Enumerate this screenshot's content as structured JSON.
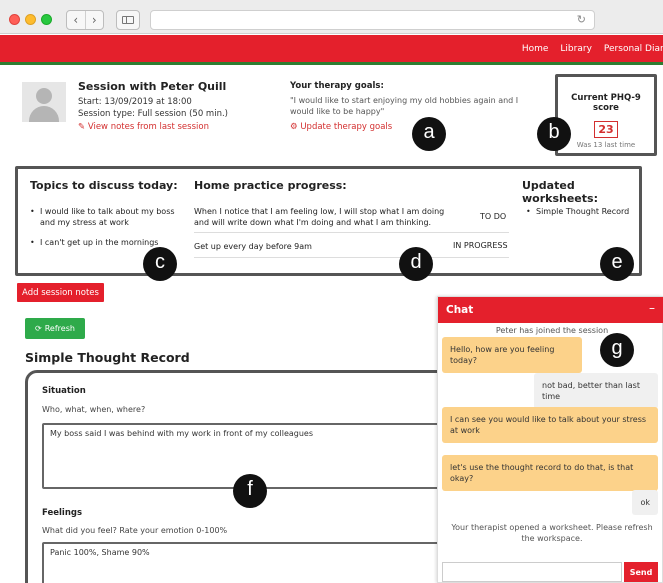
{
  "navbar": {
    "links": [
      "Home",
      "Library",
      "Personal Diary"
    ]
  },
  "session": {
    "title": "Session with Peter Quill",
    "start": "Start: 13/09/2019 at 18:00",
    "type": "Session type: Full session (50 min.)",
    "notes_link": "View notes from last session"
  },
  "goals": {
    "heading": "Your therapy goals:",
    "text": "\"I would like to start enjoying my old hobbies again and I would like to be happy\"",
    "update_link": "Update therapy goals"
  },
  "phq": {
    "heading": "Current PHQ-9 score",
    "score": "23",
    "last": "Was 13 last time"
  },
  "topics": {
    "heading": "Topics to discuss today:",
    "items": [
      "I would like to talk about my boss and my stress at work",
      "I can't get up in the mornings"
    ]
  },
  "home_practice": {
    "heading": "Home practice progress:",
    "items": [
      {
        "text": "When I notice that I am feeling low, I will stop what I am doing and will write down what I'm doing and what I am thinking.",
        "status": "TO DO"
      },
      {
        "text": "Get up every day before 9am",
        "status": "IN PROGRESS"
      }
    ]
  },
  "worksheets": {
    "heading": "Updated worksheets:",
    "items": [
      "Simple Thought Record"
    ]
  },
  "buttons": {
    "add_notes": "Add session notes",
    "refresh": "Refresh"
  },
  "thought_record": {
    "title": "Simple Thought Record",
    "situation_label": "Situation",
    "situation_sub": "Who, what, when, where?",
    "situation_value": "My boss said I was behind with my work in front of my colleagues",
    "feelings_label": "Feelings",
    "feelings_sub": "What did you feel? Rate your emotion 0-100%",
    "feelings_value": "Panic 100%, Shame 90%"
  },
  "chat": {
    "title": "Chat",
    "minimize": "–",
    "joined": "Peter has joined the session",
    "messages": [
      {
        "from": "therapist",
        "text": "Hello, how are you feeling today?"
      },
      {
        "from": "client",
        "text": "not bad, better than last time"
      },
      {
        "from": "therapist",
        "text": "I can see you would like to talk about your stress at work"
      },
      {
        "from": "therapist",
        "text": "let's use the thought record to do that, is that okay?"
      },
      {
        "from": "client",
        "text": "ok"
      }
    ],
    "notice": "Your therapist opened a worksheet. Please refresh the workspace.",
    "send": "Send"
  },
  "callouts": [
    "a",
    "b",
    "c",
    "d",
    "e",
    "f",
    "g"
  ],
  "colors": {
    "brand_red": "#e4202c",
    "green": "#2eaa4a",
    "chat_bubble": "#fcd28a"
  }
}
